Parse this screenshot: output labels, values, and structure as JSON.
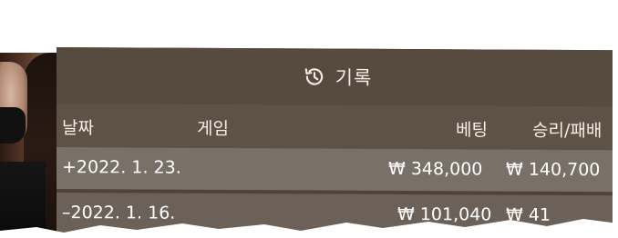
{
  "header": {
    "title": "기록",
    "icon": "history-icon"
  },
  "table": {
    "columns": {
      "date": "날짜",
      "game": "게임",
      "bet": "베팅",
      "result": "승리/패배"
    },
    "rows": [
      {
        "date": "+2022. 1. 23.",
        "bet": "₩ 348,000",
        "result": "₩ 140,700"
      },
      {
        "date": "–2022. 1. 16.",
        "bet": "₩ 101,040",
        "result": "₩ 41"
      }
    ]
  },
  "colors": {
    "panel": "#4e4338",
    "header": "#574b40",
    "column_header": "#5e5145",
    "row_highlight": "#797068",
    "row": "#6b6158",
    "text": "#ffffff"
  }
}
